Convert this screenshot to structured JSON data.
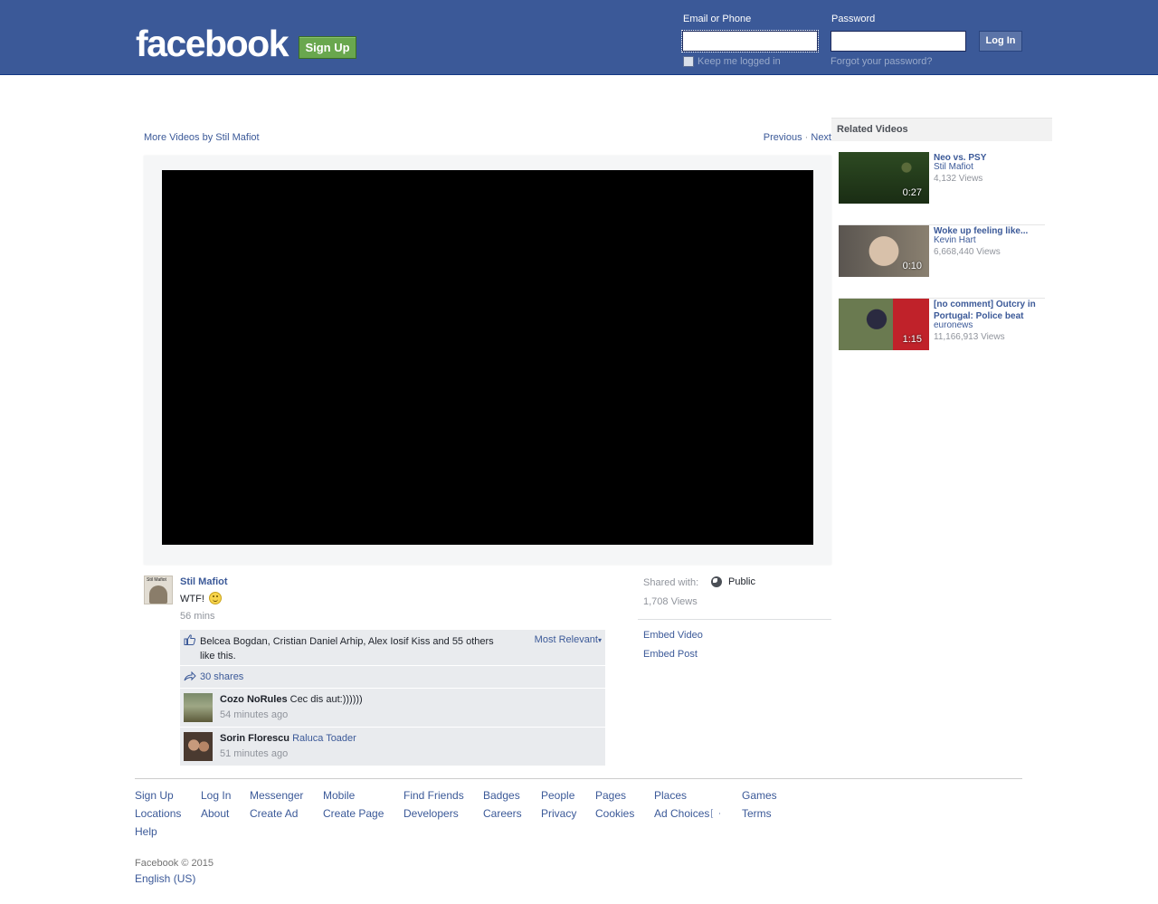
{
  "header": {
    "logo": "facebook",
    "signup_label": "Sign Up",
    "email_label": "Email or Phone",
    "password_label": "Password",
    "email_value": "",
    "password_value": "",
    "login_label": "Log In",
    "keep_logged_in": "Keep me logged in",
    "forgot_password": "Forgot your password?"
  },
  "video_nav": {
    "more_videos": "More Videos by Stil Mafiot",
    "previous": "Previous",
    "separator": "·",
    "next": "Next"
  },
  "post": {
    "author": "Stil Mafiot",
    "text": "WTF!",
    "time": "56 mins",
    "likes_text": "Belcea Bogdan, Cristian Daniel Arhip, Alex Iosif Kiss and 55 others like this.",
    "sort_label": "Most Relevant",
    "shares": "30 shares",
    "comments": [
      {
        "name": "Cozo NoRules",
        "text": "Cec dis aut:))))))",
        "tag": "",
        "time": "54 minutes ago"
      },
      {
        "name": "Sorin Florescu",
        "text": "",
        "tag": "Raluca Toader",
        "time": "51 minutes ago"
      }
    ]
  },
  "post_meta": {
    "shared_with_label": "Shared with:",
    "audience": "Public",
    "views": "1,708 Views",
    "embed_video": "Embed Video",
    "embed_post": "Embed Post"
  },
  "related": {
    "heading": "Related Videos",
    "items": [
      {
        "title": "Neo vs. PSY",
        "author": "Stil Mafiot",
        "views": "4,132 Views",
        "duration": "0:27"
      },
      {
        "title": "Woke up feeling like...",
        "author": "Kevin Hart",
        "views": "6,668,440 Views",
        "duration": "0:10"
      },
      {
        "title": "[no comment] Outcry in Portugal: Police beat",
        "author": "euronews",
        "views": "11,166,913 Views",
        "duration": "1:15"
      }
    ]
  },
  "footer": {
    "links": [
      "Sign Up",
      "Log In",
      "Messenger",
      "Mobile",
      "Find Friends",
      "Badges",
      "People",
      "Pages",
      "Places",
      "Games",
      "Locations",
      "About",
      "Create Ad",
      "Create Page",
      "Developers",
      "Careers",
      "Privacy",
      "Cookies",
      "Ad Choices",
      "Terms",
      "Help"
    ],
    "copyright": "Facebook © 2015",
    "language": "English (US)"
  },
  "colors": {
    "brand_blue": "#3b5998",
    "signup_green": "#69a74e",
    "player_black": "#000000"
  }
}
